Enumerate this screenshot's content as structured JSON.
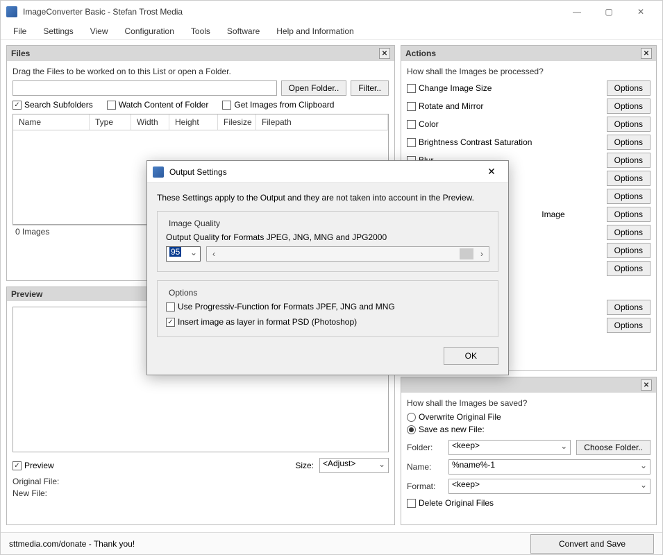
{
  "window": {
    "title": "ImageConverter Basic - Stefan Trost Media"
  },
  "menu": [
    "File",
    "Settings",
    "View",
    "Configuration",
    "Tools",
    "Software",
    "Help and Information"
  ],
  "files_panel": {
    "title": "Files",
    "hint": "Drag the Files to be worked on to this List or open a Folder.",
    "open_folder": "Open Folder..",
    "filter": "Filter..",
    "chk_subfolders": "Search Subfolders",
    "chk_watch": "Watch Content of Folder",
    "chk_clipboard": "Get Images from Clipboard",
    "columns": [
      "Name",
      "Type",
      "Width",
      "Height",
      "Filesize",
      "Filepath"
    ],
    "status": "0 Images"
  },
  "preview_panel": {
    "title": "Preview",
    "chk_preview": "Preview",
    "size_label": "Size:",
    "size_value": "<Adjust>",
    "orig_label": "Original File:",
    "new_label": "New File:"
  },
  "actions_panel": {
    "title": "Actions",
    "hint": "How shall the Images be processed?",
    "items": [
      "Change Image Size",
      "Rotate and Mirror",
      "Color",
      "Brightness Contrast Saturation",
      "Blur"
    ],
    "partial_item": "Image",
    "options_label": "Options"
  },
  "save_panel": {
    "hint": "How shall the Images be saved?",
    "radio_overwrite": "Overwrite Original File",
    "radio_savenew": "Save as new File:",
    "folder_label": "Folder:",
    "folder_value": "<keep>",
    "choose_folder": "Choose Folder..",
    "name_label": "Name:",
    "name_value": "%name%-1",
    "format_label": "Format:",
    "format_value": "<keep>",
    "chk_delete": "Delete Original Files"
  },
  "footer": {
    "donate": "sttmedia.com/donate - Thank you!",
    "convert": "Convert and Save"
  },
  "dialog": {
    "title": "Output Settings",
    "intro": "These Settings apply to the Output and they are not taken into account in the Preview.",
    "quality_legend": "Image Quality",
    "quality_hint": "Output Quality for Formats JPEG, JNG, MNG and JPG2000",
    "quality_value": "95",
    "options_legend": "Options",
    "chk_progressive": "Use Progressiv-Function for Formats JPEF, JNG and MNG",
    "chk_psd": "Insert image as layer in format PSD (Photoshop)",
    "ok": "OK"
  }
}
